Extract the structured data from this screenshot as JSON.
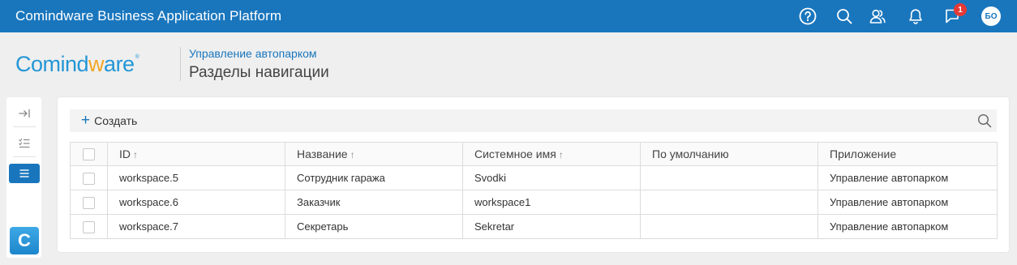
{
  "topbar": {
    "title": "Comindware Business Application Platform",
    "notifications_badge": "1",
    "avatar_initials": "БО",
    "bg_color": "#1976bd"
  },
  "header": {
    "logo_part1": "Comind",
    "logo_part2": "w",
    "logo_part3": "are",
    "logo_reg": "®",
    "breadcrumb": "Управление автопарком",
    "title": "Разделы навигации"
  },
  "rail": {
    "c_logo": "C"
  },
  "toolbar": {
    "create_plus": "+",
    "create_label": "Создать"
  },
  "table": {
    "columns": [
      {
        "label": "ID",
        "sort": "↑"
      },
      {
        "label": "Название",
        "sort": "↑"
      },
      {
        "label": "Системное имя",
        "sort": "↑"
      },
      {
        "label": "По умолчанию",
        "sort": ""
      },
      {
        "label": "Приложение",
        "sort": ""
      }
    ],
    "rows": [
      {
        "id": "workspace.5",
        "name": "Сотрудник гаража",
        "system_name": "Svodki",
        "default": "",
        "app": "Управление автопарком"
      },
      {
        "id": "workspace.6",
        "name": "Заказчик",
        "system_name": "workspace1",
        "default": "",
        "app": "Управление автопарком"
      },
      {
        "id": "workspace.7",
        "name": "Секретарь",
        "system_name": "Sekretar",
        "default": "",
        "app": "Управление автопарком"
      }
    ]
  }
}
